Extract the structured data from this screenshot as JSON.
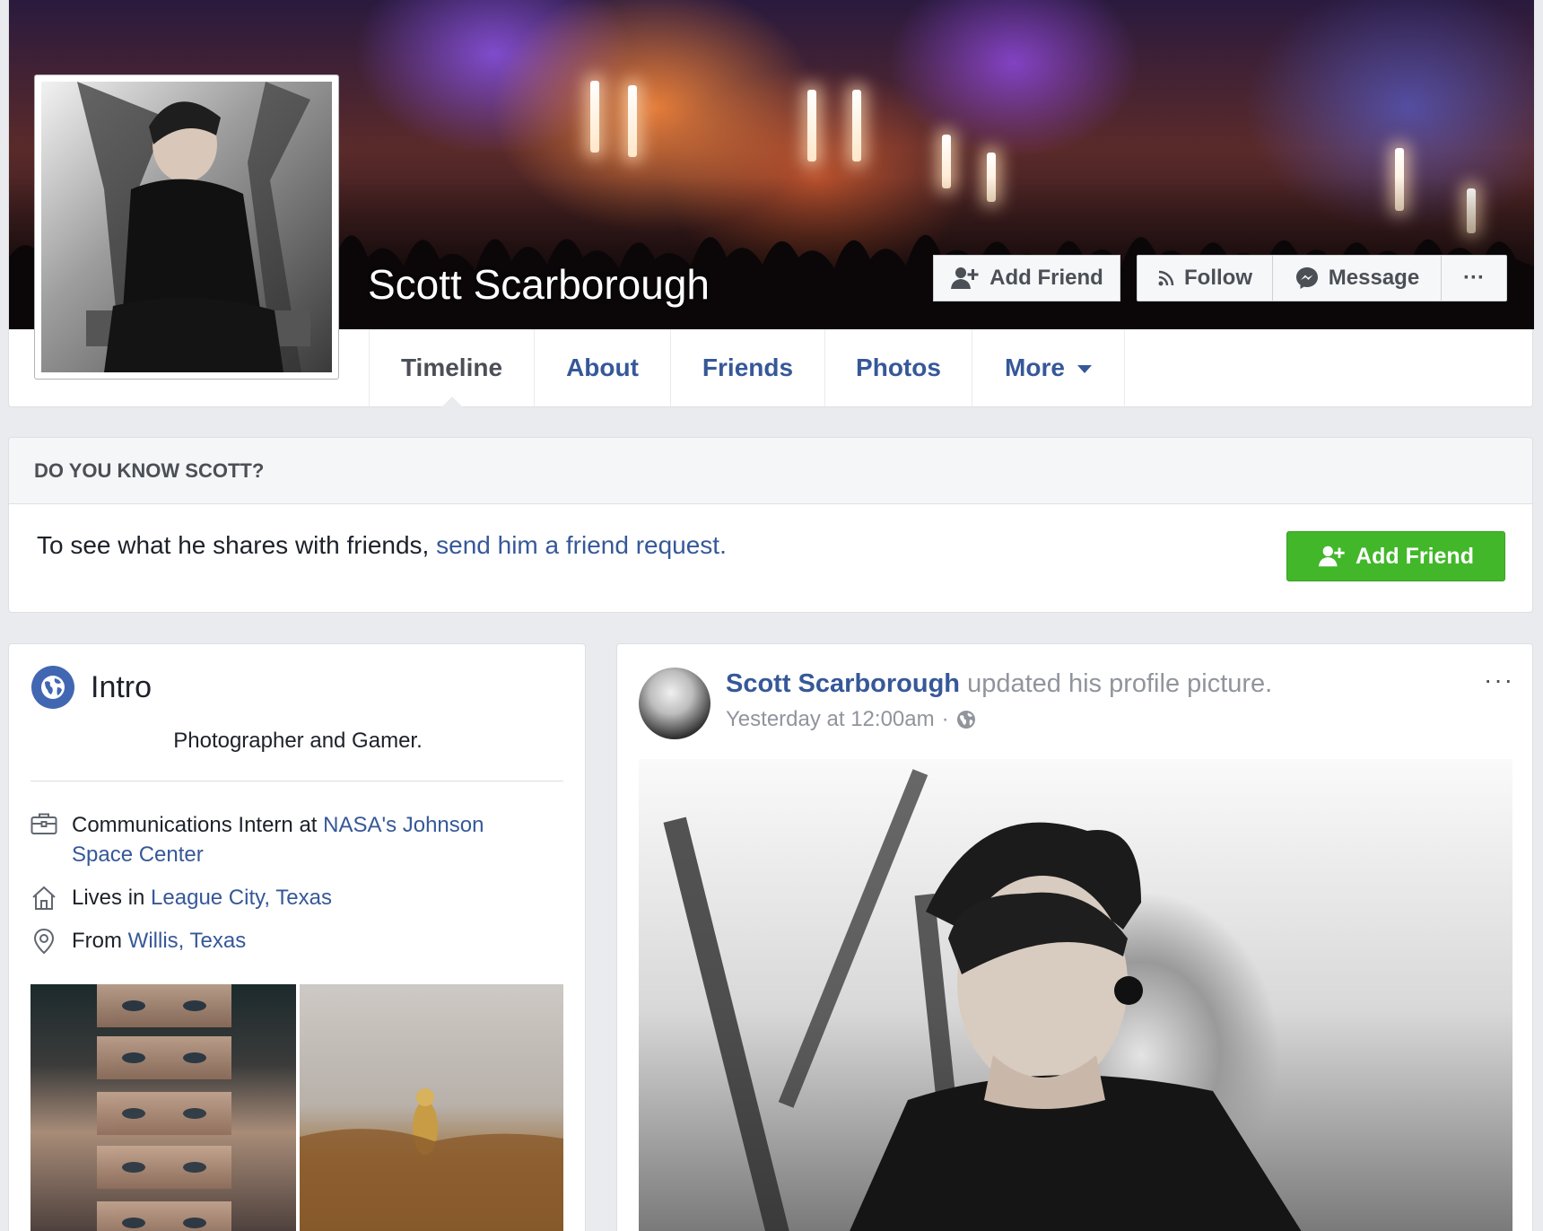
{
  "profile": {
    "name": "Scott Scarborough"
  },
  "cover_actions": {
    "add_friend": "Add Friend",
    "follow": "Follow",
    "message": "Message",
    "more": "···"
  },
  "tabs": [
    {
      "label": "Timeline",
      "active": true
    },
    {
      "label": "About"
    },
    {
      "label": "Friends"
    },
    {
      "label": "Photos"
    },
    {
      "label": "More"
    }
  ],
  "know_card": {
    "heading": "DO YOU KNOW SCOTT?",
    "text": "To see what he shares with friends, ",
    "link": "send him a friend request.",
    "button": "Add Friend"
  },
  "intro": {
    "title": "Intro",
    "bio": "Photographer and Gamer.",
    "work_prefix": "Communications Intern at ",
    "work_link_line1": "NASA's Johnson",
    "work_link_line2": "Space Center",
    "lives_prefix": "Lives in ",
    "lives_link": "League City, Texas",
    "from_prefix": "From ",
    "from_link": "Willis, Texas"
  },
  "post": {
    "author": "Scott Scarborough",
    "action": " updated his profile picture.",
    "timestamp": "Yesterday at 12:00am",
    "separator": "·",
    "more": "···"
  },
  "icons": {
    "add_friend": "person-plus-icon",
    "follow": "rss-icon",
    "message": "messenger-icon",
    "intro": "globe-icon",
    "work": "briefcase-icon",
    "home": "house-icon",
    "from": "location-pin-icon",
    "privacy": "globe-icon"
  },
  "colors": {
    "link": "#365899",
    "green_button": "#42b72a",
    "background": "#e9ebee",
    "intro_badge": "#4267b2"
  }
}
